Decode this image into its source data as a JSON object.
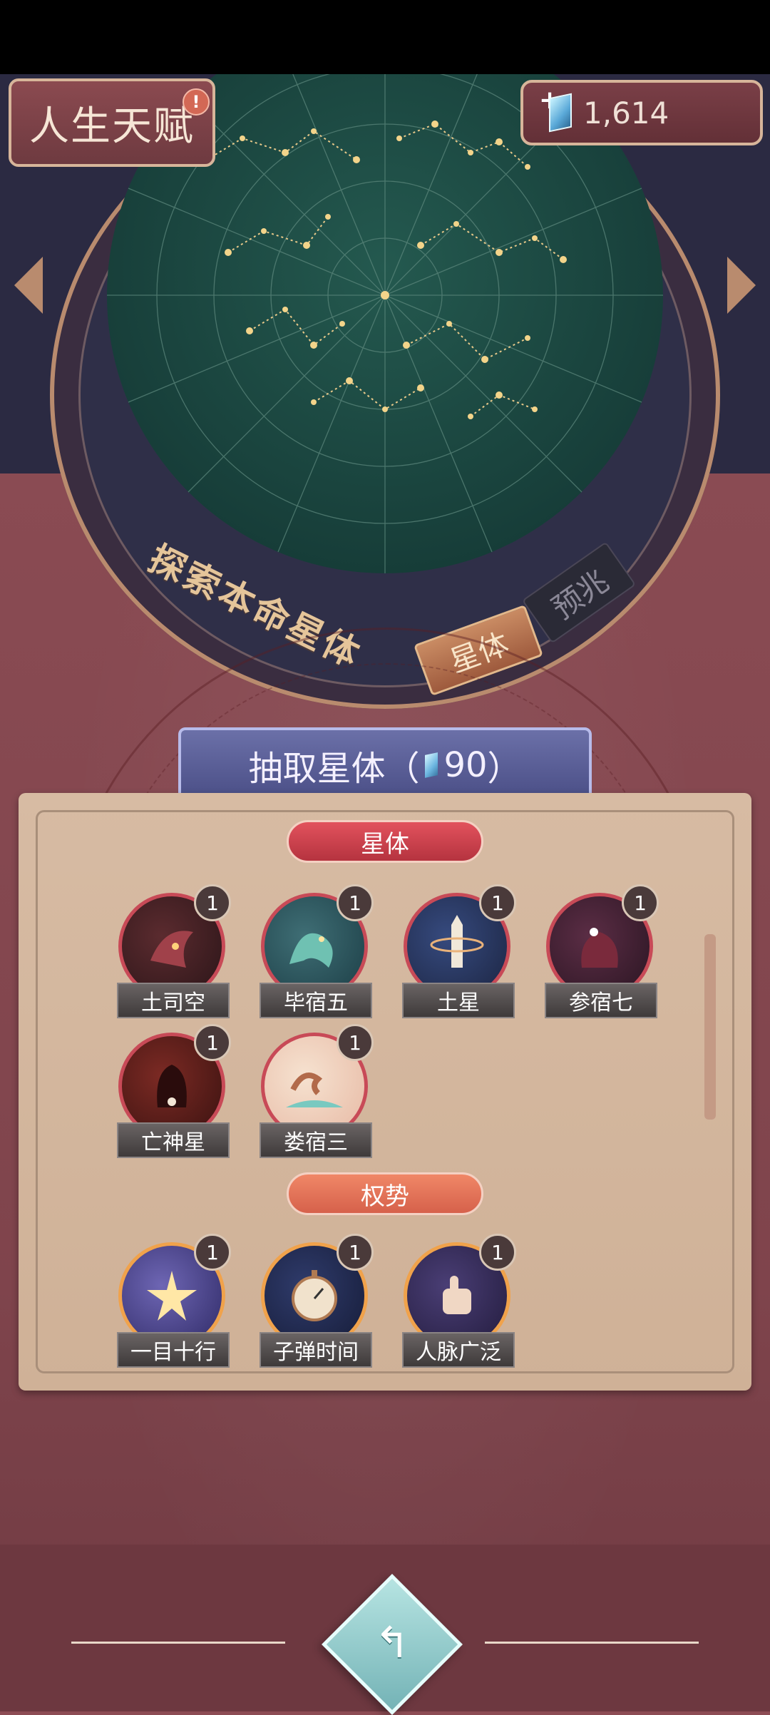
{
  "header": {
    "title": "人生天赋",
    "alert_badge": "!",
    "currency": {
      "plus": "+",
      "icon": "crystal-icon",
      "value": "1,614"
    }
  },
  "starmap": {
    "label": "探索本命星体",
    "tabs": [
      {
        "label": "星体",
        "active": true
      },
      {
        "label": "预兆",
        "active": false
      }
    ]
  },
  "draw_button": {
    "prefix": "抽取星体（",
    "cost": "90",
    "suffix": "）"
  },
  "sections": [
    {
      "title": "星体",
      "items": [
        {
          "label": "土司空",
          "count": "1"
        },
        {
          "label": "毕宿五",
          "count": "1"
        },
        {
          "label": "土星",
          "count": "1"
        },
        {
          "label": "参宿七",
          "count": "1"
        },
        {
          "label": "亡神星",
          "count": "1"
        },
        {
          "label": "娄宿三",
          "count": "1"
        }
      ]
    },
    {
      "title": "权势",
      "items": [
        {
          "label": "一目十行",
          "count": "1"
        },
        {
          "label": "子弹时间",
          "count": "1"
        },
        {
          "label": "人脉广泛",
          "count": "1"
        }
      ]
    }
  ],
  "colors": {
    "background": "#8c4c54",
    "map": "#1b4a44",
    "accent_red": "#c84a57",
    "accent_gold": "#f0a24b",
    "parchment": "#d7bba3"
  }
}
